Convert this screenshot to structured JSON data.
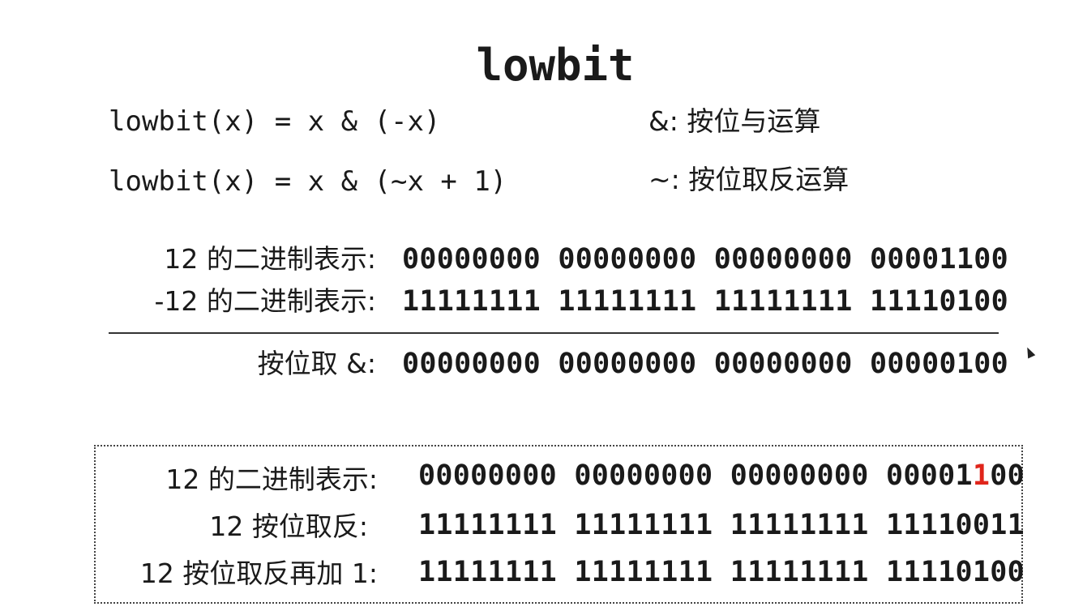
{
  "title": "lowbit",
  "formulas": [
    {
      "expr": "lowbit(x) = x & (-x)",
      "note": "&: 按位与运算"
    },
    {
      "expr": "lowbit(x) = x & (~x + 1)",
      "note": "~: 按位取反运算"
    }
  ],
  "and_example": {
    "rows": [
      {
        "label": "12 的二进制表示:",
        "bits": "00000000 00000000 00000000 00001100"
      },
      {
        "label": "-12 的二进制表示:",
        "bits": "11111111 11111111 11111111 11110100"
      }
    ],
    "result": {
      "label": "按位取 &:",
      "bits": "00000000 00000000 00000000 00000100"
    }
  },
  "complement_example": {
    "rows": [
      {
        "label": "12 的二进制表示:",
        "bits_prefix": "00000000 00000000 00000000 00001",
        "bits_highlight": "1",
        "bits_suffix": "00"
      },
      {
        "label": "12 按位取反:",
        "bits": "11111111 11111111 11111111 11110011"
      },
      {
        "label": "12 按位取反再加 1:",
        "bits": "11111111 11111111 11111111 11110100"
      }
    ]
  },
  "colors": {
    "highlight": "#e0251b",
    "text": "#1a1a1a",
    "background": "#ffffff"
  },
  "icons": {
    "cursor": "mouse-pointer-icon"
  }
}
